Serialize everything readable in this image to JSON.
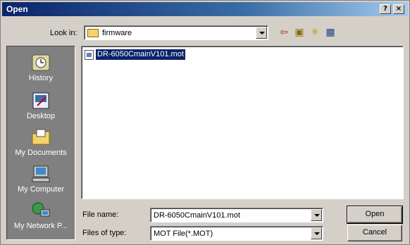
{
  "window": {
    "title": "Open",
    "help_label": "?",
    "close_label": "×"
  },
  "look_in": {
    "label": "Look in:",
    "value": "firmware"
  },
  "toolbar": {
    "back_glyph": "⇦",
    "up_glyph": "▣",
    "new_folder_glyph": "✳",
    "views_glyph": "▦"
  },
  "places": [
    {
      "label": "History",
      "icon": "history-icon"
    },
    {
      "label": "Desktop",
      "icon": "desktop-icon"
    },
    {
      "label": "My Documents",
      "icon": "my-documents-icon"
    },
    {
      "label": "My Computer",
      "icon": "my-computer-icon"
    },
    {
      "label": "My Network P...",
      "icon": "my-network-icon"
    }
  ],
  "files": [
    {
      "name": "DR-6050CmainV101.mot",
      "selected": true
    }
  ],
  "file_name": {
    "label": "File name:",
    "value": "DR-6050CmainV101.mot"
  },
  "file_type": {
    "label": "Files of type:",
    "value": "MOT File(*.MOT)"
  },
  "buttons": {
    "open": "Open",
    "cancel": "Cancel"
  }
}
